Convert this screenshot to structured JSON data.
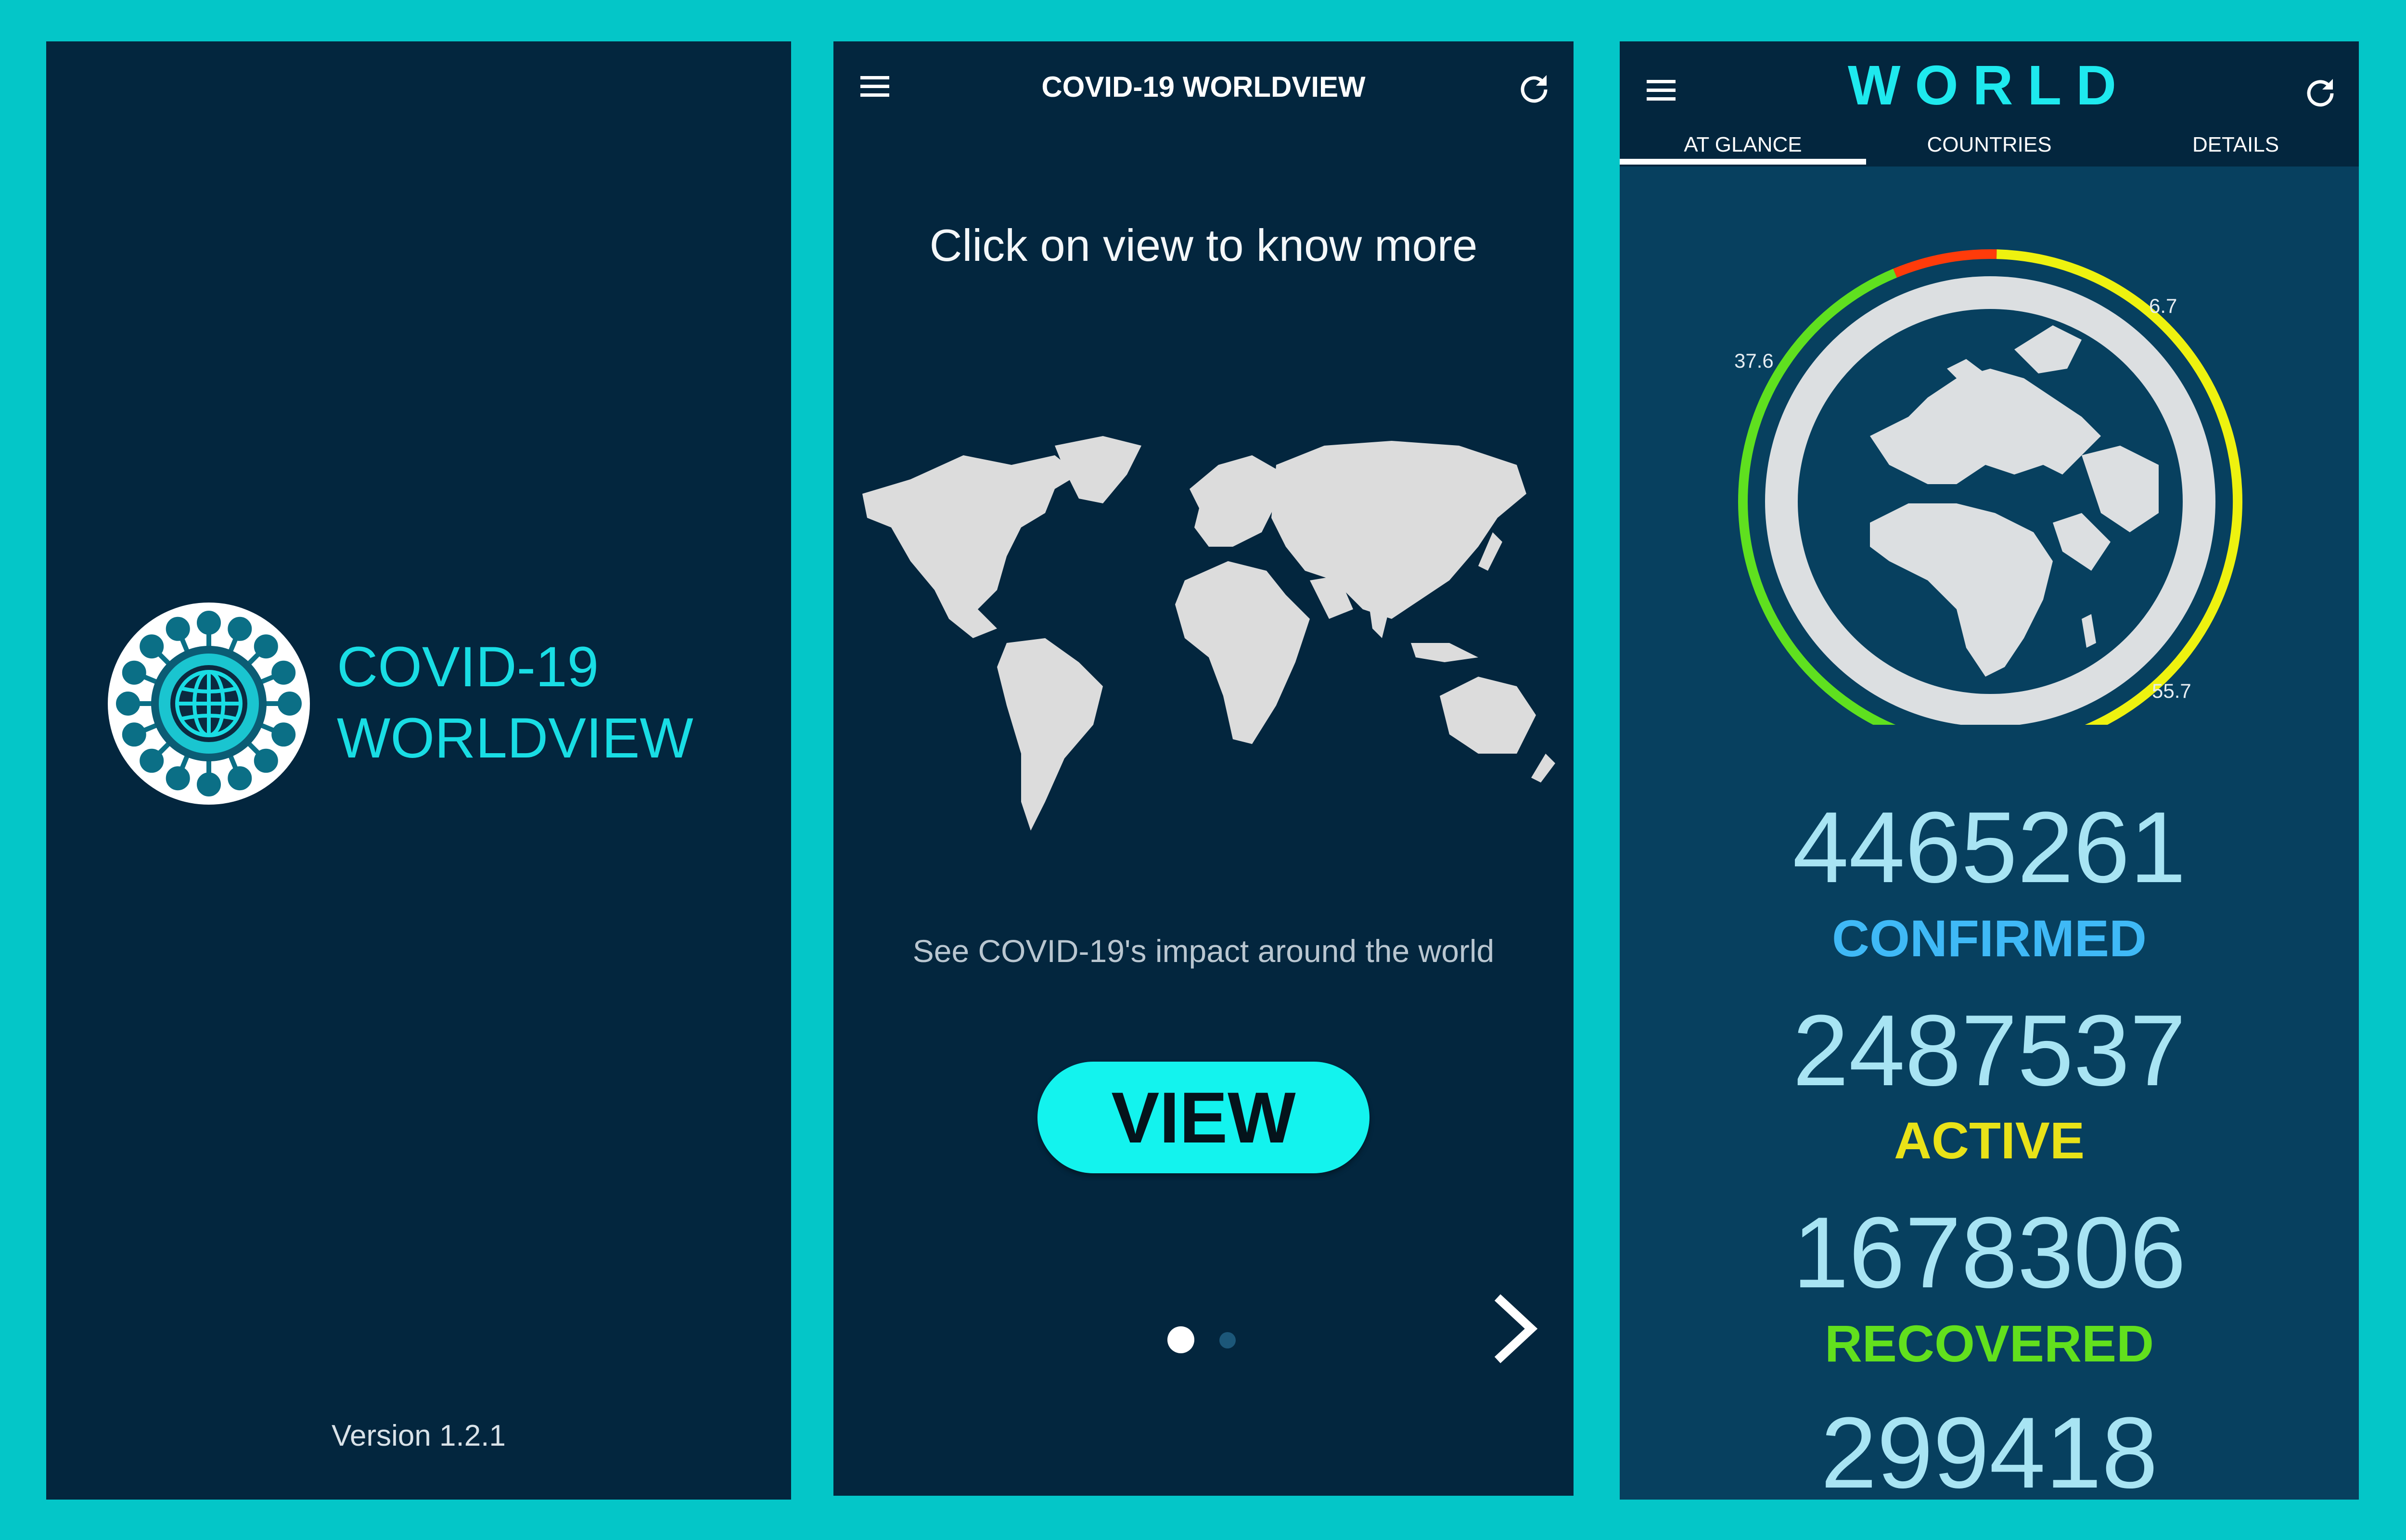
{
  "splash": {
    "title_line1": "COVID-19",
    "title_line2": "WORLDVIEW",
    "version": "Version 1.2.1",
    "logo_icon": "virus-globe-icon"
  },
  "onboarding": {
    "toolbar": {
      "title": "COVID-19 WORLDVIEW",
      "menu_icon": "menu-icon",
      "refresh_icon": "refresh-icon"
    },
    "headline": "Click on view to know more",
    "subtext": "See COVID-19's impact around the world",
    "view_button": "VIEW",
    "page_indicator": {
      "current": 1,
      "total": 2
    },
    "next_icon": "chevron-right-icon"
  },
  "world": {
    "toolbar": {
      "title": "WORLD",
      "menu_icon": "menu-icon",
      "refresh_icon": "refresh-icon"
    },
    "tabs": [
      {
        "label": "AT GLANCE",
        "selected": true
      },
      {
        "label": "COUNTRIES",
        "selected": false
      },
      {
        "label": "DETAILS",
        "selected": false
      }
    ],
    "ring": {
      "segments": [
        {
          "label": "37.6",
          "value": 37.6,
          "color": "#5fe01f"
        },
        {
          "label": "6.7",
          "value": 6.7,
          "color": "#ff3b0a"
        },
        {
          "label": "55.7",
          "value": 55.7,
          "color": "#eef20f"
        }
      ]
    },
    "stats": [
      {
        "value": "4465261",
        "label": "CONFIRMED",
        "color": "#3fb9f6"
      },
      {
        "value": "2487537",
        "label": "ACTIVE",
        "color": "#e9e218"
      },
      {
        "value": "1678306",
        "label": "RECOVERED",
        "color": "#62e01d"
      },
      {
        "value": "299418",
        "label": "",
        "color": "#a8e4f3"
      }
    ]
  },
  "colors": {
    "background": "#04c6c8",
    "panel": "#03263e",
    "accent": "#19dde4"
  }
}
